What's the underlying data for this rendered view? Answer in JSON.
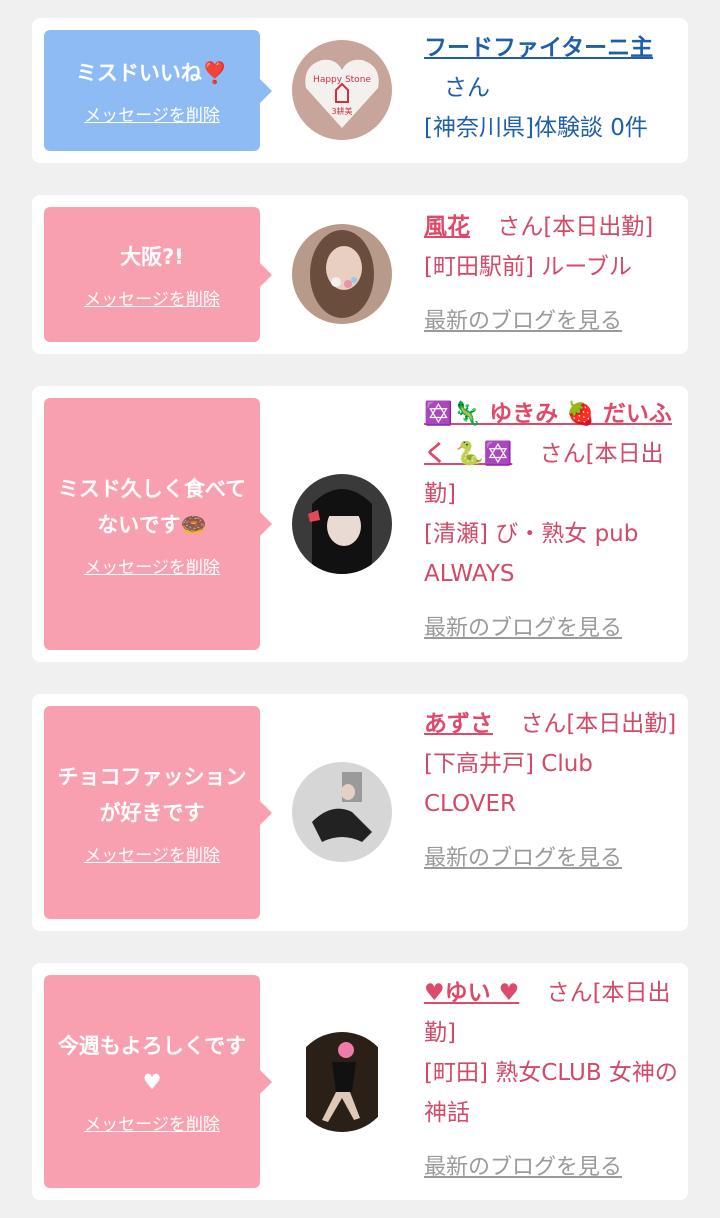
{
  "cards": [
    {
      "message": "ミスドいいね❣️",
      "delete_label": "メッセージを削除",
      "name": "フードファイターニ主",
      "san": "さん",
      "status": "",
      "area": "[神奈川県]体験談 0件",
      "blog": ""
    },
    {
      "message": "大阪?!",
      "delete_label": "メッセージを削除",
      "name": "風花",
      "san": "さん",
      "status": "[本日出勤]",
      "area": "[町田駅前] ルーブル",
      "blog": "最新のブログを見る"
    },
    {
      "message": "ミスド久しく食べてないです🍩",
      "delete_label": "メッセージを削除",
      "name": "✡️🦎 ゆきみ 🍓 だいふく 🐍✡️",
      "san": "さん",
      "status": "[本日出勤]",
      "area": "[清瀬] び・熟女 pub ALWAYS",
      "blog": "最新のブログを見る"
    },
    {
      "message": "チョコファッションが好きです",
      "delete_label": "メッセージを削除",
      "name": "あずさ",
      "san": "さん",
      "status": "[本日出勤]",
      "area": "[下高井戸] Club CLOVER",
      "blog": "最新のブログを見る"
    },
    {
      "message": "今週もよろしくです♥",
      "delete_label": "メッセージを削除",
      "name": "♥ゆい ♥",
      "san": "さん",
      "status": "[本日出勤]",
      "area": "[町田] 熟女CLUB 女神の神話",
      "blog": "最新のブログを見る"
    }
  ],
  "colors": {
    "blue_bubble": "#8fbbf4",
    "pink_bubble": "#f9a0b0",
    "name_blue": "#1f5fa8",
    "name_pink": "#de4a6a",
    "link_gray": "#9a9a9a"
  }
}
